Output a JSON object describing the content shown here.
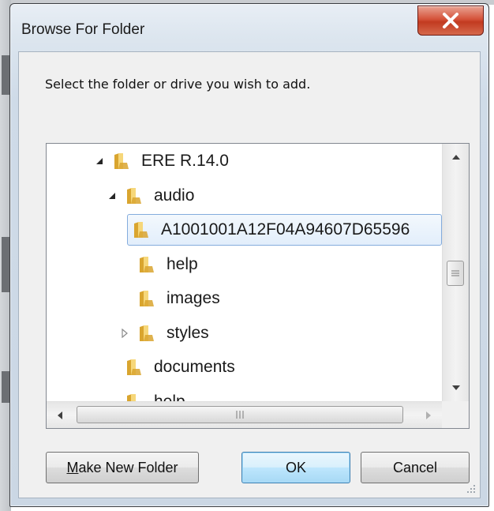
{
  "window": {
    "title": "Browse For Folder",
    "close_label": "X"
  },
  "prompt": "Select the folder or drive you wish to add.",
  "tree": {
    "nodes": [
      {
        "label": "ERE R.14.0",
        "level": 1,
        "expander": "expanded"
      },
      {
        "label": "audio",
        "level": 2,
        "expander": "expanded"
      },
      {
        "label": "A1001001A12F04A94607D65596",
        "level": 3,
        "expander": "none",
        "selected": true
      },
      {
        "label": "help",
        "level": 3,
        "expander": "none"
      },
      {
        "label": "images",
        "level": 3,
        "expander": "none"
      },
      {
        "label": "styles",
        "level": 3,
        "expander": "collapsed"
      },
      {
        "label": "documents",
        "level": 2,
        "expander": "none"
      },
      {
        "label": "help",
        "level": 2,
        "expander": "none"
      }
    ]
  },
  "buttons": {
    "make_new_folder_accel": "M",
    "make_new_folder_rest": "ake New Folder",
    "ok": "OK",
    "cancel": "Cancel"
  },
  "colors": {
    "folder_light": "#f6d77a",
    "folder_dark": "#d9a52f",
    "selection_border": "#84acdd"
  }
}
